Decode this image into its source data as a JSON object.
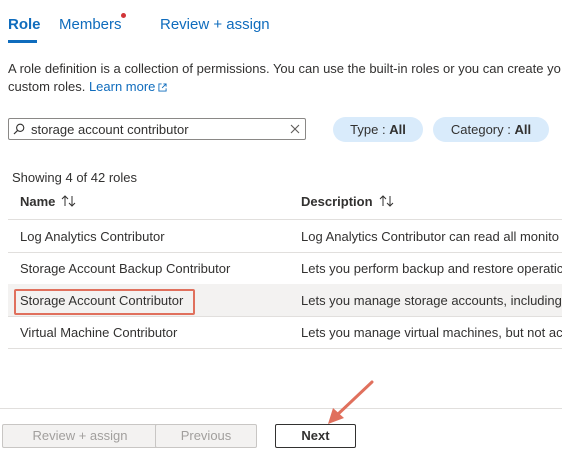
{
  "tabs": {
    "role": "Role",
    "members": "Members",
    "review": "Review + assign"
  },
  "description": {
    "line1": "A role definition is a collection of permissions. You can use the built-in roles or you can create yo",
    "line2": "custom roles.",
    "learn_more": "Learn more"
  },
  "search": {
    "value": "storage account contributor"
  },
  "filters": {
    "type_label": "Type : ",
    "type_value": "All",
    "category_label": "Category : ",
    "category_value": "All"
  },
  "table": {
    "showing": "Showing 4 of 42 roles",
    "columns": {
      "name": "Name",
      "description": "Description"
    },
    "rows": [
      {
        "name": "Log Analytics Contributor",
        "description": "Log Analytics Contributor can read all monito"
      },
      {
        "name": "Storage Account Backup Contributor",
        "description": "Lets you perform backup and restore operatic"
      },
      {
        "name": "Storage Account Contributor",
        "description": "Lets you manage storage accounts, including"
      },
      {
        "name": "Virtual Machine Contributor",
        "description": "Lets you manage virtual machines, but not acc"
      }
    ],
    "selected_row": "Storage Account Contributor"
  },
  "footer": {
    "review_assign": "Review + assign",
    "previous": "Previous",
    "next": "Next"
  },
  "colors": {
    "accent": "#0f6cbd",
    "annotation": "#e0705d",
    "notification_dot": "#d13438",
    "filter_pill": "#d9ebfb"
  }
}
